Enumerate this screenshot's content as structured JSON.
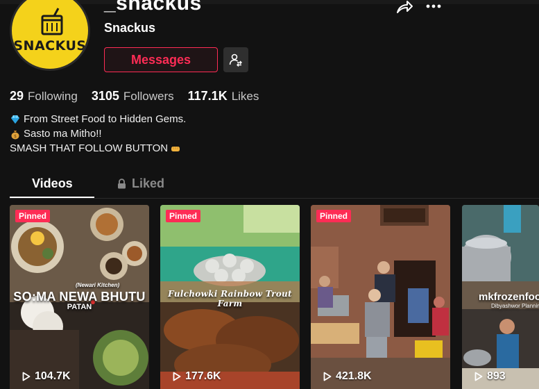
{
  "profile": {
    "username": "_snackus",
    "display_name": "Snackus",
    "avatar_text": "SNACKUS"
  },
  "actions": {
    "messages_label": "Messages"
  },
  "stats": {
    "following_count": "29",
    "following_label": "Following",
    "followers_count": "3105",
    "followers_label": "Followers",
    "likes_count": "117.1K",
    "likes_label": "Likes"
  },
  "bio": {
    "line1": "From Street Food to Hidden Gems.",
    "line2": "Sasto ma Mitho!!",
    "line3": "SMASH THAT FOLLOW BUTTON"
  },
  "tabs": {
    "videos": "Videos",
    "liked": "Liked"
  },
  "videos": [
    {
      "pinned": "Pinned",
      "views": "104.7K",
      "overlay": "SO:MA NEWA BHUTU",
      "sub": "PATAN",
      "tag": "(Newari Kitchen)"
    },
    {
      "pinned": "Pinned",
      "views": "177.6K",
      "overlay": "Fulchowki Rainbow Trout Farm"
    },
    {
      "pinned": "Pinned",
      "views": "421.8K"
    },
    {
      "views": "893",
      "overlay": "mkfrozenfoo",
      "sub": "Dibyashwor Planning"
    }
  ],
  "colors": {
    "accent": "#fe2c55",
    "background": "#121212",
    "avatar": "#f4d21b"
  },
  "icons": [
    "share-icon",
    "more-icon",
    "follow-user-icon",
    "lock-icon",
    "play-icon",
    "diamond-emoji",
    "money-bag-emoji",
    "fist-emoji"
  ]
}
